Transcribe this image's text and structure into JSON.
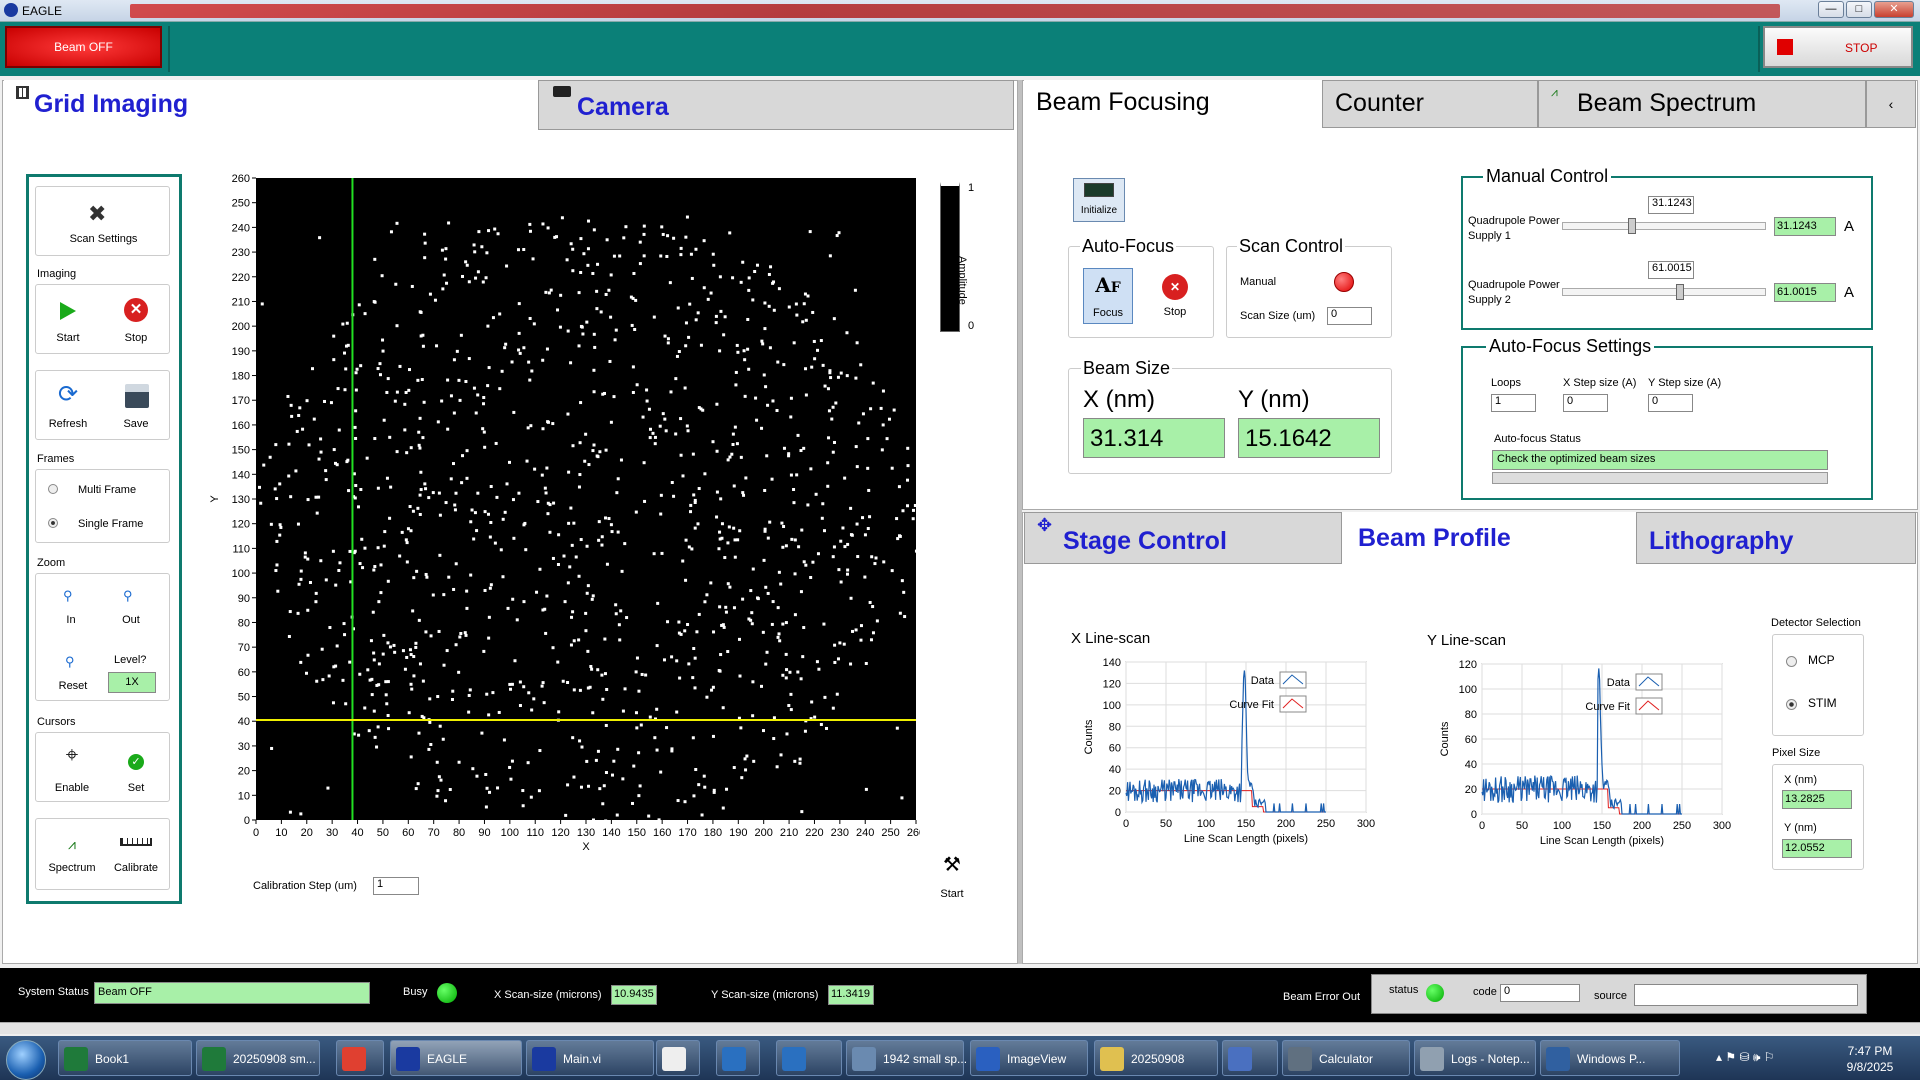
{
  "window": {
    "title": "EAGLE",
    "min": "—",
    "max": "□",
    "close": "✕"
  },
  "top": {
    "beam_off": "Beam OFF",
    "stop": "STOP"
  },
  "left_tabs": {
    "grid": "Grid Imaging",
    "camera": "Camera"
  },
  "tools": {
    "scan_settings": "Scan Settings",
    "imaging": "Imaging",
    "start": "Start",
    "stop": "Stop",
    "refresh": "Refresh",
    "save": "Save",
    "frames": "Frames",
    "multi": "Multi Frame",
    "single": "Single Frame",
    "zoom": "Zoom",
    "in": "In",
    "out": "Out",
    "reset": "Reset",
    "level_q": "Level?",
    "level": "1X",
    "cursors": "Cursors",
    "enable": "Enable",
    "set": "Set",
    "spectrum": "Spectrum",
    "calibrate": "Calibrate"
  },
  "image": {
    "y_label": "Y",
    "x_label": "X",
    "ticks": [
      "0",
      "10",
      "20",
      "30",
      "40",
      "50",
      "60",
      "70",
      "80",
      "90",
      "100",
      "110",
      "120",
      "130",
      "140",
      "150",
      "160",
      "170",
      "180",
      "190",
      "200",
      "210",
      "220",
      "230",
      "240",
      "250",
      "260"
    ],
    "amp_label": "Amplitude",
    "amp_max": "1",
    "amp_min": "0",
    "calib_label": "Calibration Step (um)",
    "calib_value": "1",
    "start": "Start"
  },
  "right_tabs": {
    "focus": "Beam Focusing",
    "counter": "Counter",
    "spectrum": "Beam Spectrum",
    "arrow": "‹"
  },
  "focusing": {
    "initialize": "Initialize",
    "af_title": "Auto-Focus",
    "focus": "Focus",
    "stop": "Stop",
    "scan_title": "Scan Control",
    "manual": "Manual",
    "scan_size_label": "Scan Size (um)",
    "scan_size": "0",
    "beam_size_title": "Beam Size",
    "x_label": "X (nm)",
    "y_label": "Y (nm)",
    "x_value": "31.314",
    "y_value": "15.1642"
  },
  "manual": {
    "title": "Manual Control",
    "q1_label": "Quadrupole Power Supply 1",
    "q1_top": "31.1243",
    "q1_value": "31.1243",
    "q2_label": "Quadrupole Power Supply 2",
    "q2_top": "61.0015",
    "q2_value": "61.0015",
    "unit": "A"
  },
  "afs": {
    "title": "Auto-Focus Settings",
    "loops_l": "Loops",
    "loops": "1",
    "xstep_l": "X Step size (A)",
    "xstep": "0",
    "ystep_l": "Y Step size (A)",
    "ystep": "0",
    "status_l": "Auto-focus Status",
    "status": "Check the optimized beam sizes"
  },
  "lower_tabs": {
    "stage": "Stage Control",
    "profile": "Beam Profile",
    "litho": "Lithography"
  },
  "xscan": {
    "title": "X Line-scan",
    "ylabel": "Counts",
    "xlabel": "Line Scan Length (pixels)",
    "yticks": [
      "0",
      "20",
      "40",
      "60",
      "80",
      "100",
      "120",
      "140"
    ],
    "xticks": [
      "0",
      "50",
      "100",
      "150",
      "200",
      "250",
      "300"
    ],
    "data": "Data",
    "fit": "Curve Fit"
  },
  "yscan": {
    "title": "Y Line-scan",
    "ylabel": "Counts",
    "xlabel": "Line Scan Length (pixels)",
    "yticks": [
      "0",
      "20",
      "40",
      "60",
      "80",
      "100",
      "120"
    ],
    "xticks": [
      "0",
      "50",
      "100",
      "150",
      "200",
      "250",
      "300"
    ],
    "data": "Data",
    "fit": "Curve Fit"
  },
  "detector": {
    "title": "Detector Selection",
    "mcp": "MCP",
    "stim": "STIM",
    "pixel_title": "Pixel Size",
    "x_l": "X (nm)",
    "x": "13.2825",
    "y_l": "Y (nm)",
    "y": "12.0552"
  },
  "status": {
    "sys_l": "System Status",
    "sys": "Beam OFF",
    "busy": "Busy",
    "xs_l": "X Scan-size (microns)",
    "xs": "10.9435",
    "ys_l": "Y Scan-size (microns)",
    "ys": "11.3419",
    "err": "Beam Error Out",
    "st": "status",
    "code": "code",
    "code_v": "0",
    "source": "source"
  },
  "taskbar": [
    {
      "label": "Book1"
    },
    {
      "label": "20250908 sm..."
    },
    {
      "label": ""
    },
    {
      "label": "EAGLE"
    },
    {
      "label": "Main.vi"
    },
    {
      "label": ""
    },
    {
      "label": ""
    },
    {
      "label": ""
    },
    {
      "label": "1942 small sp..."
    },
    {
      "label": "ImageView"
    },
    {
      "label": "20250908"
    },
    {
      "label": ""
    },
    {
      "label": "Calculator"
    },
    {
      "label": "Logs - Notep..."
    },
    {
      "label": "Windows P..."
    }
  ],
  "clock": {
    "time": "7:47 PM",
    "date": "9/8/2025"
  }
}
